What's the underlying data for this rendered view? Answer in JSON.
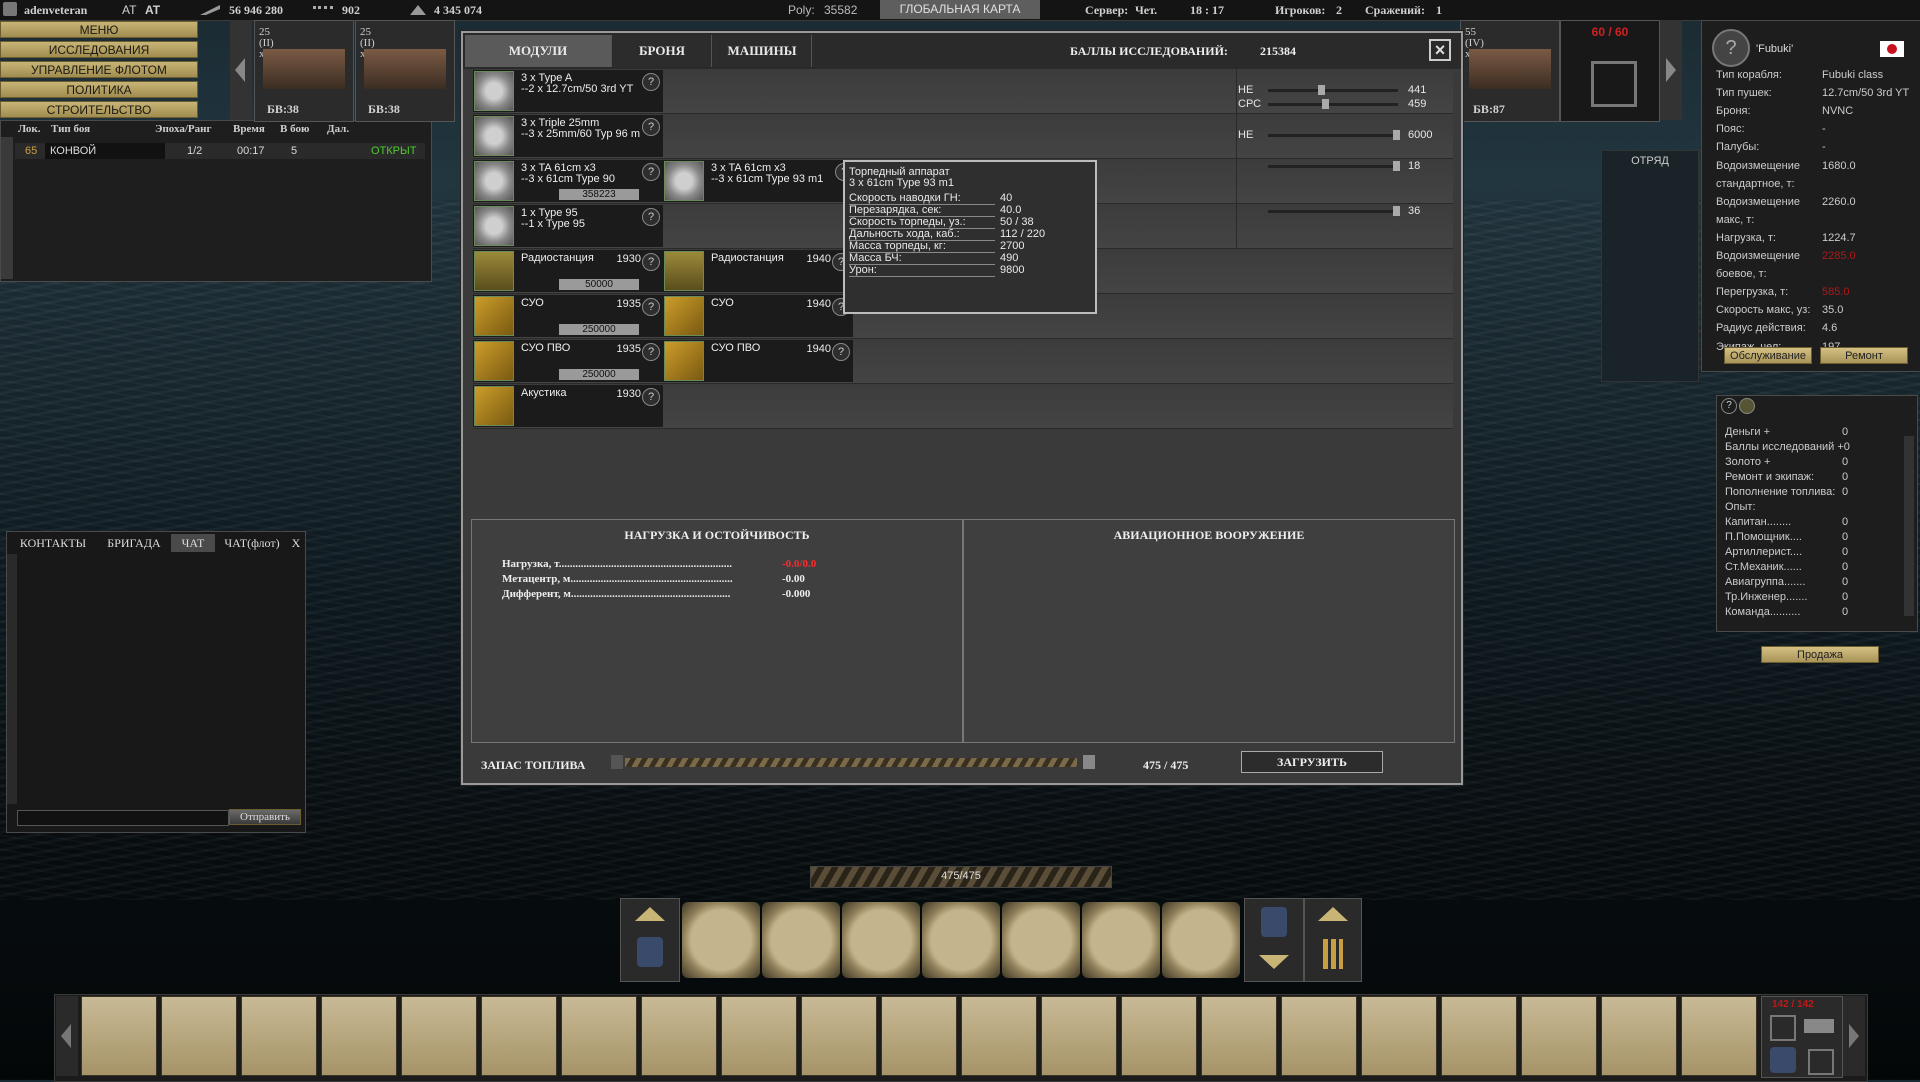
{
  "topbar": {
    "username": "adenveteran",
    "tag1": "AT",
    "tag2": "AT",
    "money": "56 946 280",
    "ammo": "902",
    "gold": "4 345 074",
    "poly_label": "Poly:",
    "poly_value": "35582",
    "global_map": "ГЛОБАЛЬНАЯ КАРТА",
    "server_label": "Сервер:",
    "server_value": "Чет.",
    "time": "18 : 17",
    "players_label": "Игроков:",
    "players_value": "2",
    "battles_label": "Сражений:",
    "battles_value": "1"
  },
  "menu": [
    "МЕНЮ",
    "ИССЛЕДОВАНИЯ",
    "УПРАВЛЕНИЕ ФЛОТОМ",
    "ПОЛИТИКА",
    "СТРОИТЕЛЬСТВО"
  ],
  "battles": {
    "headers": [
      "Лок.",
      "Тип боя",
      "Эпоха/Ранг",
      "Время",
      "В бою",
      "Дал."
    ],
    "row": {
      "loc": "65",
      "type": "КОНВОЙ",
      "rank": "1/2",
      "time": "00:17",
      "in_battle": "5",
      "status": "ОТКРЫТ"
    }
  },
  "ships": [
    {
      "tier": "25",
      "rank": "(II)",
      "mult": "x1",
      "label": "БВ:38"
    },
    {
      "tier": "25",
      "rank": "(II)",
      "mult": "x1",
      "label": "БВ:38"
    },
    {
      "tier": "55",
      "rank": "(IV)",
      "mult": "x1",
      "label": "БВ:87"
    }
  ],
  "build_slot": {
    "count": "60 / 60"
  },
  "squad_label": "ОТРЯД",
  "dialog": {
    "tabs": [
      "МОДУЛИ",
      "БРОНЯ",
      "МАШИНЫ"
    ],
    "research_label": "БАЛЛЫ ИССЛЕДОВАНИЙ:",
    "research_value": "215384",
    "modules": [
      {
        "l1": "3 x Type A",
        "l2": "--2 x 12.7cm/50 3rd YT"
      },
      {
        "l1": "3 x Triple 25mm",
        "l2": "--3 x 25mm/60 Typ 96 m"
      },
      {
        "l1": "3 x TA 61cm x3",
        "l2": "--3 x 61cm Type 90",
        "price": "358223"
      },
      {
        "l1": "1 x Type 95",
        "l2": "--1 x Type 95"
      },
      {
        "l1": "Радиостанция",
        "year": "1930",
        "price": "50000"
      },
      {
        "l1": "СУО",
        "year": "1935",
        "price": "250000"
      },
      {
        "l1": "СУО ПВО",
        "year": "1935",
        "price": "250000"
      },
      {
        "l1": "Акустика",
        "year": "1930"
      }
    ],
    "upgrades": [
      {
        "l1": "3 x TA 61cm x3",
        "l2": "--3 x 61cm Type 93 m1"
      },
      {
        "l1": "Радиостанция",
        "year": "1940"
      },
      {
        "l1": "СУО",
        "year": "1940"
      },
      {
        "l1": "СУО ПВО",
        "year": "1940"
      }
    ],
    "ammo": [
      {
        "label": "НЕ",
        "value": "441",
        "level": 0.4
      },
      {
        "label": "СРС",
        "value": "459",
        "level": 0.43
      },
      {
        "label": "НЕ",
        "value": "6000",
        "level": 1.0
      },
      {
        "label": "",
        "value": "18",
        "level": 1.0
      },
      {
        "label": "",
        "value": "36",
        "level": 1.0
      }
    ],
    "tooltip": {
      "title": "Торпедный аппарат",
      "subtitle": "3 x 61cm Type 93 m1",
      "stats": [
        {
          "k": "Скорость наводки ГН:",
          "v": "40"
        },
        {
          "k": "Перезарядка, сек:",
          "v": "40.0"
        },
        {
          "k": "Скорость торпеды, уз.:",
          "v": "50 / 38"
        },
        {
          "k": "Дальность хода, каб.:",
          "v": "112 / 220"
        },
        {
          "k": "Масса торпеды, кг:",
          "v": "2700"
        },
        {
          "k": "Масса БЧ:",
          "v": "490"
        },
        {
          "k": "Урон:",
          "v": "9800"
        }
      ]
    },
    "load_panel": {
      "title": "НАГРУЗКА И ОСТОЙЧИВОСТЬ",
      "rows": [
        {
          "k": "Нагрузка, т...............................................................",
          "v": "-0.0/0.0",
          "color": "#ff2a2a"
        },
        {
          "k": "Метацентр, м...........................................................",
          "v": "-0.00",
          "color": "#eeeeee"
        },
        {
          "k": "Дифферент, м..........................................................",
          "v": "-0.000",
          "color": "#eeeeee"
        }
      ]
    },
    "air_panel": {
      "title": "АВИАЦИОННОЕ ВООРУЖЕНИЕ"
    },
    "fuel": {
      "label": "ЗАПАС ТОПЛИВА",
      "value": "475 / 475",
      "load_button": "ЗАГРУЗИТЬ"
    }
  },
  "ship_info": {
    "name": "'Fubuki'",
    "rows": [
      {
        "k": "Тип корабля:",
        "v": "Fubuki class"
      },
      {
        "k": "Тип пушек:",
        "v": "12.7cm/50 3rd YT"
      },
      {
        "k": "Броня:",
        "v": "NVNC"
      },
      {
        "k": "Пояс:",
        "v": "-"
      },
      {
        "k": "Палубы:",
        "v": "-"
      },
      {
        "k": "Водоизмещение",
        "v": "1680.0"
      },
      {
        "k": " стандартное, т:",
        "v": ""
      },
      {
        "k": "Водоизмещение",
        "v": "2260.0"
      },
      {
        "k": " макс, т:",
        "v": ""
      },
      {
        "k": "Нагрузка, т:",
        "v": "1224.7"
      },
      {
        "k": "Водоизмещение",
        "v": "2285.0"
      },
      {
        "k": " боевое, т:",
        "v": ""
      },
      {
        "k": "Перегрузка, т:",
        "v": "585.0"
      },
      {
        "k": "Скорость макс, уз:",
        "v": "35.0"
      },
      {
        "k": "Радиус действия:",
        "v": "4.6"
      },
      {
        "k": "Экипаж, чел:",
        "v": "197"
      }
    ],
    "service_button": "Обслуживание",
    "repair_button": "Ремонт"
  },
  "rewards": {
    "rows": [
      {
        "k": "Деньги +",
        "v": "0"
      },
      {
        "k": "Баллы исследований +0",
        "v": ""
      },
      {
        "k": "Золото +",
        "v": "0"
      },
      {
        "k": "Ремонт и экипаж:",
        "v": "0"
      },
      {
        "k": "Пополнение топлива:",
        "v": "0"
      },
      {
        "k": "Опыт:",
        "v": ""
      },
      {
        "k": "Капитан........",
        "v": "0"
      },
      {
        "k": "П.Помощник....",
        "v": "0"
      },
      {
        "k": "Артиллерист....",
        "v": "0"
      },
      {
        "k": "Ст.Механик......",
        "v": "0"
      },
      {
        "k": "Авиагруппа.......",
        "v": "0"
      },
      {
        "k": "Тр.Инженер.......",
        "v": "0"
      },
      {
        "k": "Команда..........",
        "v": "0"
      }
    ],
    "sell_button": "Продажа"
  },
  "chat": {
    "tabs": [
      "КОНТАКТЫ",
      "БРИГАДА",
      "ЧАТ",
      "ЧАТ(флот)",
      "X"
    ],
    "send_button": "Отправить",
    "input_value": ""
  },
  "fuel_bar": "475/475",
  "bottom_counter": "142 / 142"
}
